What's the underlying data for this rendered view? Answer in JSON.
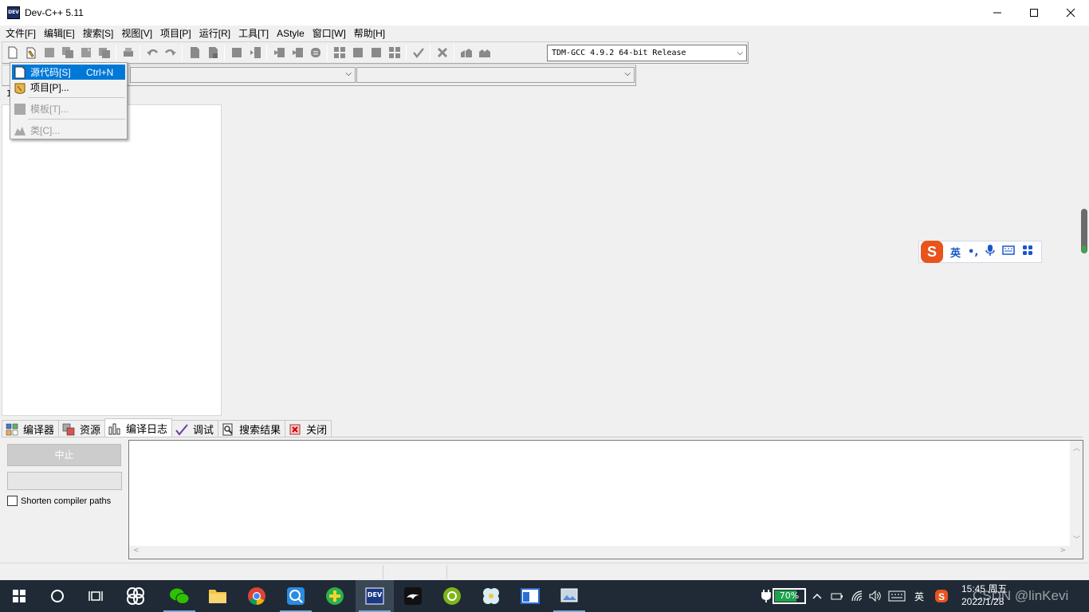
{
  "window": {
    "title": "Dev-C++ 5.11",
    "icon_label": "DEV"
  },
  "menubar": [
    "文件[F]",
    "编辑[E]",
    "搜索[S]",
    "视图[V]",
    "项目[P]",
    "运行[R]",
    "工具[T]",
    "AStyle",
    "窗口[W]",
    "帮助[H]"
  ],
  "toolbar": {
    "compiler": "TDM-GCC 4.9.2 64-bit Release"
  },
  "left_panel": {
    "label": "1"
  },
  "new_menu": {
    "items": [
      {
        "label": "源代码[S]",
        "shortcut": "Ctrl+N",
        "state": "selected"
      },
      {
        "label": "项目[P]...",
        "shortcut": "",
        "state": "normal"
      },
      {
        "label": "模板[T]...",
        "shortcut": "",
        "state": "disabled"
      },
      {
        "label": "类[C]...",
        "shortcut": "",
        "state": "disabled"
      }
    ]
  },
  "bottom_tabs": [
    {
      "label": "编译器",
      "icon": "grid-icon"
    },
    {
      "label": "资源",
      "icon": "resources-icon"
    },
    {
      "label": "编译日志",
      "icon": "bar-chart-icon",
      "active": true
    },
    {
      "label": "调试",
      "icon": "checkmark-icon"
    },
    {
      "label": "搜索结果",
      "icon": "search-doc-icon"
    },
    {
      "label": "关闭",
      "icon": "close-icon"
    }
  ],
  "compile_log": {
    "stop_button": "中止",
    "shorten_paths_label": "Shorten compiler paths"
  },
  "ime": {
    "lang": "英",
    "punct": "•,",
    "logo": "S"
  },
  "taskbar": {
    "battery": "70%",
    "lang": "英",
    "time": "15:45 周五",
    "date": "2022/1/28"
  },
  "watermark": "CSDN @linKevi",
  "colors": {
    "accent": "#0078d7",
    "taskbar": "#1f2a36",
    "ime_brand": "#e9541d"
  }
}
